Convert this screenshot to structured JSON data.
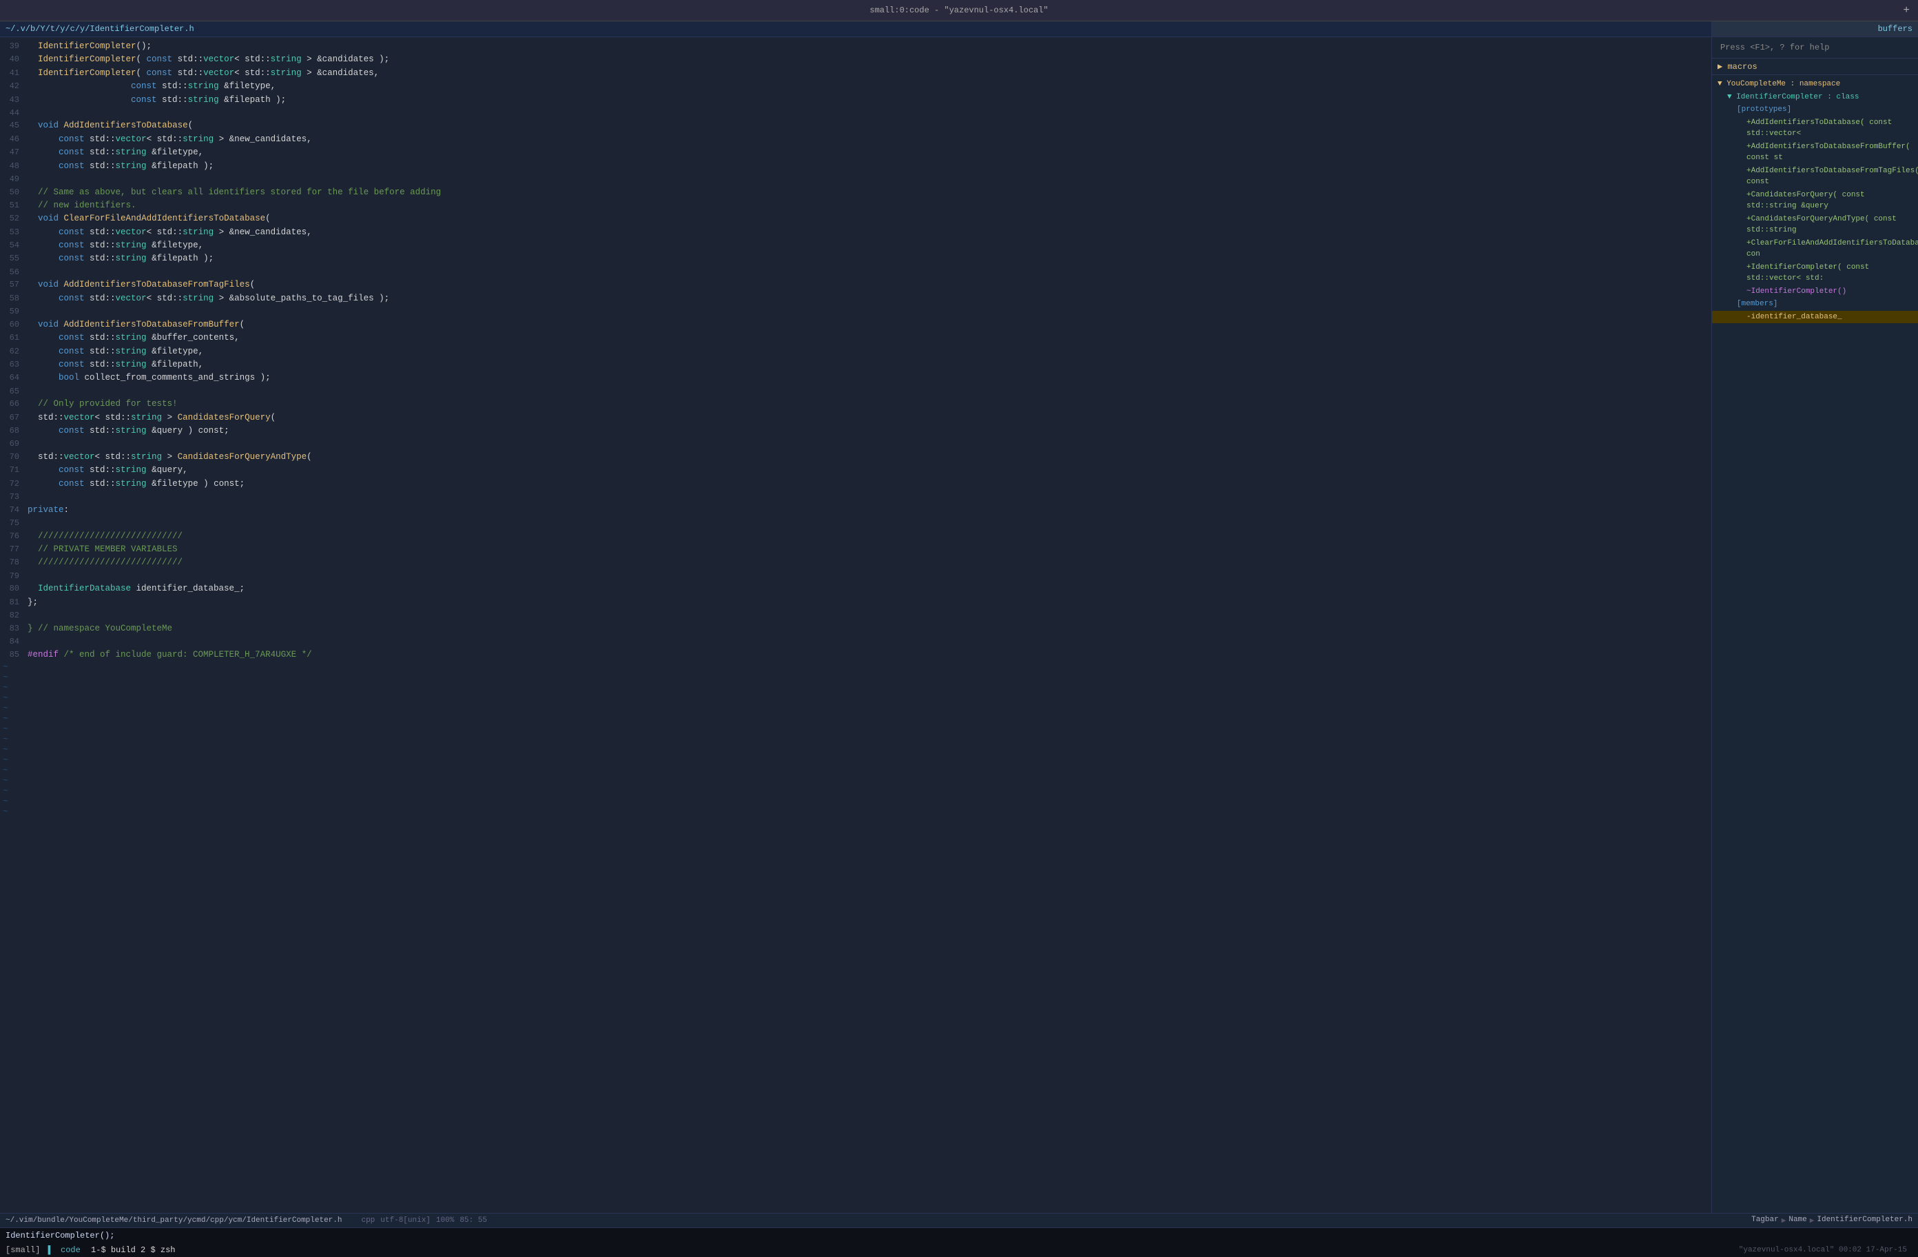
{
  "title_bar": {
    "text": "small:0:code - \"yazevnul-osx4.local\"",
    "add_btn": "+"
  },
  "tab": {
    "label": "~/.v/b/Y/t/y/c/y/IdentifierCompleter.h"
  },
  "sidebar": {
    "help_text": "Press <F1>, ? for help",
    "sections_label": "macros",
    "buffers_label": "buffers",
    "tree": [
      {
        "indent": 0,
        "arrow": "▼",
        "text": "YouCompleteMe : namespace",
        "color": "ns"
      },
      {
        "indent": 1,
        "arrow": "▼",
        "text": "IdentifierCompleter : class",
        "color": "class"
      },
      {
        "indent": 2,
        "text": "[prototypes]",
        "color": "proto"
      },
      {
        "indent": 3,
        "text": "+AddIdentifiersToDatabase( const std::vector<",
        "color": "fn-add"
      },
      {
        "indent": 3,
        "text": "+AddIdentifiersToDatabaseFromBuffer( const st",
        "color": "fn-add"
      },
      {
        "indent": 3,
        "text": "+AddIdentifiersToDatabaseFromTagFiles( const",
        "color": "fn-add"
      },
      {
        "indent": 3,
        "text": "+CandidatesForQuery( const std::string &query",
        "color": "fn-add"
      },
      {
        "indent": 3,
        "text": "+CandidatesForQueryAndType( const std::string",
        "color": "fn-add"
      },
      {
        "indent": 3,
        "text": "+ClearForFileAndAddIdentifiersToDatabase( con",
        "color": "fn-add"
      },
      {
        "indent": 3,
        "text": "+IdentifierCompleter( const std::vector< std:",
        "color": "fn-add"
      },
      {
        "indent": 3,
        "text": "~IdentifierCompleter()",
        "color": "tilde"
      },
      {
        "indent": 2,
        "text": "[members]",
        "color": "proto"
      },
      {
        "indent": 3,
        "text": "-identifier_database_",
        "color": "member-highlight",
        "highlight": true
      }
    ]
  },
  "code_lines": [
    {
      "num": 39,
      "tokens": [
        {
          "t": "  IdentifierCompleter",
          "c": "fn-yellow"
        },
        {
          "t": "();",
          "c": "white"
        }
      ]
    },
    {
      "num": 40,
      "tokens": [
        {
          "t": "  IdentifierCompleter",
          "c": "fn-yellow"
        },
        {
          "t": "( ",
          "c": "white"
        },
        {
          "t": "const",
          "c": "kw"
        },
        {
          "t": " std::",
          "c": "white"
        },
        {
          "t": "vector",
          "c": "type"
        },
        {
          "t": "< std::",
          "c": "white"
        },
        {
          "t": "string",
          "c": "type"
        },
        {
          "t": " > &candidates );",
          "c": "white"
        }
      ]
    },
    {
      "num": 41,
      "tokens": [
        {
          "t": "  IdentifierCompleter",
          "c": "fn-yellow"
        },
        {
          "t": "( ",
          "c": "white"
        },
        {
          "t": "const",
          "c": "kw"
        },
        {
          "t": " std::",
          "c": "white"
        },
        {
          "t": "vector",
          "c": "type"
        },
        {
          "t": "< std::",
          "c": "white"
        },
        {
          "t": "string",
          "c": "type"
        },
        {
          "t": " > &candidates,",
          "c": "white"
        }
      ]
    },
    {
      "num": 42,
      "tokens": [
        {
          "t": "                    ",
          "c": "white"
        },
        {
          "t": "const",
          "c": "kw"
        },
        {
          "t": " std::",
          "c": "white"
        },
        {
          "t": "string",
          "c": "type"
        },
        {
          "t": " &filetype,",
          "c": "white"
        }
      ]
    },
    {
      "num": 43,
      "tokens": [
        {
          "t": "                    ",
          "c": "white"
        },
        {
          "t": "const",
          "c": "kw"
        },
        {
          "t": " std::",
          "c": "white"
        },
        {
          "t": "string",
          "c": "type"
        },
        {
          "t": " &filepath );",
          "c": "white"
        }
      ]
    },
    {
      "num": 44,
      "tokens": []
    },
    {
      "num": 45,
      "tokens": [
        {
          "t": "  ",
          "c": "white"
        },
        {
          "t": "void",
          "c": "kw"
        },
        {
          "t": " ",
          "c": "white"
        },
        {
          "t": "AddIdentifiersToDatabase",
          "c": "fn-yellow"
        },
        {
          "t": "(",
          "c": "white"
        }
      ]
    },
    {
      "num": 46,
      "tokens": [
        {
          "t": "      ",
          "c": "white"
        },
        {
          "t": "const",
          "c": "kw"
        },
        {
          "t": " std::",
          "c": "white"
        },
        {
          "t": "vector",
          "c": "type"
        },
        {
          "t": "< std::",
          "c": "white"
        },
        {
          "t": "string",
          "c": "type"
        },
        {
          "t": " > &new_candidates,",
          "c": "white"
        }
      ]
    },
    {
      "num": 47,
      "tokens": [
        {
          "t": "      ",
          "c": "white"
        },
        {
          "t": "const",
          "c": "kw"
        },
        {
          "t": " std::",
          "c": "white"
        },
        {
          "t": "string",
          "c": "type"
        },
        {
          "t": " &filetype,",
          "c": "white"
        }
      ]
    },
    {
      "num": 48,
      "tokens": [
        {
          "t": "      ",
          "c": "white"
        },
        {
          "t": "const",
          "c": "kw"
        },
        {
          "t": " std::",
          "c": "white"
        },
        {
          "t": "string",
          "c": "type"
        },
        {
          "t": " &filepath );",
          "c": "white"
        }
      ]
    },
    {
      "num": 49,
      "tokens": []
    },
    {
      "num": 50,
      "tokens": [
        {
          "t": "  // Same as above, but clears all identifiers stored for the file before adding",
          "c": "comment"
        }
      ]
    },
    {
      "num": 51,
      "tokens": [
        {
          "t": "  // new identifiers.",
          "c": "comment"
        }
      ]
    },
    {
      "num": 52,
      "tokens": [
        {
          "t": "  ",
          "c": "white"
        },
        {
          "t": "void",
          "c": "kw"
        },
        {
          "t": " ",
          "c": "white"
        },
        {
          "t": "ClearForFileAndAddIdentifiersToDatabase",
          "c": "fn-yellow"
        },
        {
          "t": "(",
          "c": "white"
        }
      ]
    },
    {
      "num": 53,
      "tokens": [
        {
          "t": "      ",
          "c": "white"
        },
        {
          "t": "const",
          "c": "kw"
        },
        {
          "t": " std::",
          "c": "white"
        },
        {
          "t": "vector",
          "c": "type"
        },
        {
          "t": "< std::",
          "c": "white"
        },
        {
          "t": "string",
          "c": "type"
        },
        {
          "t": " > &new_candidates,",
          "c": "white"
        }
      ]
    },
    {
      "num": 54,
      "tokens": [
        {
          "t": "      ",
          "c": "white"
        },
        {
          "t": "const",
          "c": "kw"
        },
        {
          "t": " std::",
          "c": "white"
        },
        {
          "t": "string",
          "c": "type"
        },
        {
          "t": " &filetype,",
          "c": "white"
        }
      ]
    },
    {
      "num": 55,
      "tokens": [
        {
          "t": "      ",
          "c": "white"
        },
        {
          "t": "const",
          "c": "kw"
        },
        {
          "t": " std::",
          "c": "white"
        },
        {
          "t": "string",
          "c": "type"
        },
        {
          "t": " &filepath );",
          "c": "white"
        }
      ]
    },
    {
      "num": 56,
      "tokens": []
    },
    {
      "num": 57,
      "tokens": [
        {
          "t": "  ",
          "c": "white"
        },
        {
          "t": "void",
          "c": "kw"
        },
        {
          "t": " ",
          "c": "white"
        },
        {
          "t": "AddIdentifiersToDatabaseFromTagFiles",
          "c": "fn-yellow"
        },
        {
          "t": "(",
          "c": "white"
        }
      ]
    },
    {
      "num": 58,
      "tokens": [
        {
          "t": "      ",
          "c": "white"
        },
        {
          "t": "const",
          "c": "kw"
        },
        {
          "t": " std::",
          "c": "white"
        },
        {
          "t": "vector",
          "c": "type"
        },
        {
          "t": "< std::",
          "c": "white"
        },
        {
          "t": "string",
          "c": "type"
        },
        {
          "t": " > &absolute_paths_to_tag_files );",
          "c": "white"
        }
      ]
    },
    {
      "num": 59,
      "tokens": []
    },
    {
      "num": 60,
      "tokens": [
        {
          "t": "  ",
          "c": "white"
        },
        {
          "t": "void",
          "c": "kw"
        },
        {
          "t": " ",
          "c": "white"
        },
        {
          "t": "AddIdentifiersToDatabaseFromBuffer",
          "c": "fn-yellow"
        },
        {
          "t": "(",
          "c": "white"
        }
      ]
    },
    {
      "num": 61,
      "tokens": [
        {
          "t": "      ",
          "c": "white"
        },
        {
          "t": "const",
          "c": "kw"
        },
        {
          "t": " std::",
          "c": "white"
        },
        {
          "t": "string",
          "c": "type"
        },
        {
          "t": " &buffer_contents,",
          "c": "white"
        }
      ]
    },
    {
      "num": 62,
      "tokens": [
        {
          "t": "      ",
          "c": "white"
        },
        {
          "t": "const",
          "c": "kw"
        },
        {
          "t": " std::",
          "c": "white"
        },
        {
          "t": "string",
          "c": "type"
        },
        {
          "t": " &filetype,",
          "c": "white"
        }
      ]
    },
    {
      "num": 63,
      "tokens": [
        {
          "t": "      ",
          "c": "white"
        },
        {
          "t": "const",
          "c": "kw"
        },
        {
          "t": " std::",
          "c": "white"
        },
        {
          "t": "string",
          "c": "type"
        },
        {
          "t": " &filepath,",
          "c": "white"
        }
      ]
    },
    {
      "num": 64,
      "tokens": [
        {
          "t": "      ",
          "c": "white"
        },
        {
          "t": "bool",
          "c": "kw"
        },
        {
          "t": " collect_from_comments_and_strings );",
          "c": "white"
        }
      ]
    },
    {
      "num": 65,
      "tokens": []
    },
    {
      "num": 66,
      "tokens": [
        {
          "t": "  // Only provided for tests!",
          "c": "comment"
        }
      ]
    },
    {
      "num": 67,
      "tokens": [
        {
          "t": "  std::",
          "c": "white"
        },
        {
          "t": "vector",
          "c": "type"
        },
        {
          "t": "< std::",
          "c": "white"
        },
        {
          "t": "string",
          "c": "type"
        },
        {
          "t": " > ",
          "c": "white"
        },
        {
          "t": "CandidatesForQuery",
          "c": "fn-yellow"
        },
        {
          "t": "(",
          "c": "white"
        }
      ]
    },
    {
      "num": 68,
      "tokens": [
        {
          "t": "      ",
          "c": "white"
        },
        {
          "t": "const",
          "c": "kw"
        },
        {
          "t": " std::",
          "c": "white"
        },
        {
          "t": "string",
          "c": "type"
        },
        {
          "t": " &query ) const;",
          "c": "white"
        }
      ]
    },
    {
      "num": 69,
      "tokens": []
    },
    {
      "num": 70,
      "tokens": [
        {
          "t": "  std::",
          "c": "white"
        },
        {
          "t": "vector",
          "c": "type"
        },
        {
          "t": "< std::",
          "c": "white"
        },
        {
          "t": "string",
          "c": "type"
        },
        {
          "t": " > ",
          "c": "white"
        },
        {
          "t": "CandidatesForQueryAndType",
          "c": "fn-yellow"
        },
        {
          "t": "(",
          "c": "white"
        }
      ]
    },
    {
      "num": 71,
      "tokens": [
        {
          "t": "      ",
          "c": "white"
        },
        {
          "t": "const",
          "c": "kw"
        },
        {
          "t": " std::",
          "c": "white"
        },
        {
          "t": "string",
          "c": "type"
        },
        {
          "t": " &query,",
          "c": "white"
        }
      ]
    },
    {
      "num": 72,
      "tokens": [
        {
          "t": "      ",
          "c": "white"
        },
        {
          "t": "const",
          "c": "kw"
        },
        {
          "t": " std::",
          "c": "white"
        },
        {
          "t": "string",
          "c": "type"
        },
        {
          "t": " &filetype ) const;",
          "c": "white"
        }
      ]
    },
    {
      "num": 73,
      "tokens": []
    },
    {
      "num": 74,
      "tokens": [
        {
          "t": "private",
          "c": "kw"
        },
        {
          "t": ":",
          "c": "white"
        }
      ]
    },
    {
      "num": 75,
      "tokens": []
    },
    {
      "num": 76,
      "tokens": [
        {
          "t": "  ////////////////////////////",
          "c": "comment"
        }
      ]
    },
    {
      "num": 77,
      "tokens": [
        {
          "t": "  // PRIVATE MEMBER VARIABLES",
          "c": "comment"
        }
      ]
    },
    {
      "num": 78,
      "tokens": [
        {
          "t": "  ////////////////////////////",
          "c": "comment"
        }
      ]
    },
    {
      "num": 79,
      "tokens": []
    },
    {
      "num": 80,
      "tokens": [
        {
          "t": "  IdentifierDatabase",
          "c": "type"
        },
        {
          "t": " identifier_database_;",
          "c": "white"
        }
      ]
    },
    {
      "num": 81,
      "tokens": [
        {
          "t": "};",
          "c": "white"
        }
      ]
    },
    {
      "num": 82,
      "tokens": []
    },
    {
      "num": 83,
      "tokens": [
        {
          "t": "} // namespace YouCompleteMe",
          "c": "comment"
        }
      ]
    },
    {
      "num": 84,
      "tokens": []
    },
    {
      "num": 85,
      "tokens": [
        {
          "t": "#endif",
          "c": "preproc"
        },
        {
          "t": " /* end of include guard: COMPLETER_H_7AR4UGXE */",
          "c": "comment"
        }
      ]
    }
  ],
  "status_bar": {
    "path": "~/.vim/bundle/YouCompleteMe/third_party/ycmd/cpp/ycm/IdentifierCompleter.h",
    "filetype": "cpp",
    "encoding": "utf-8[unix]",
    "percent": "100%",
    "cursor": "85: 55",
    "tagbar": "Tagbar",
    "tagbar_sep1": "▶",
    "name_label": "Name",
    "tagbar_sep2": "▶",
    "tagbar_file": "IdentifierCompleter.h"
  },
  "cmdline": {
    "line1": "IdentifierCompleter();",
    "prompt": "[small]",
    "icon": "▌",
    "cwd": "code",
    "cmd": "1-$ build  2 $ zsh",
    "host": "\"yazevnul-osx4.local\" 00:02  17-Apr-15"
  },
  "colors": {
    "bg_editor": "#1c2333",
    "bg_sidebar": "#1a2535",
    "bg_titlebar": "#2a2a3e",
    "accent": "#7ec8e3",
    "tab_active": "#1a2540"
  }
}
